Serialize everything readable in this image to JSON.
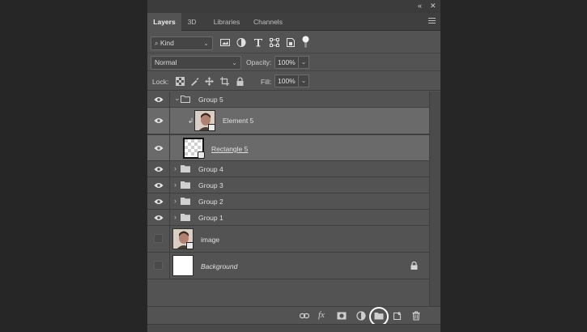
{
  "topbar": {
    "collapse_label": "«",
    "close_label": "✕"
  },
  "tabs": [
    {
      "label": "Layers",
      "active": true
    },
    {
      "label": "3D",
      "active": false
    },
    {
      "label": "Libraries",
      "active": false
    },
    {
      "label": "Channels",
      "active": false
    }
  ],
  "filter": {
    "kind_label": "Kind",
    "icons": [
      "pixel-filter-icon",
      "adjustment-filter-icon",
      "type-filter-icon",
      "shape-filter-icon",
      "smart-object-filter-icon",
      "filter-toggle-icon"
    ]
  },
  "blend": {
    "mode": "Normal",
    "opacity_label": "Opacity:",
    "opacity": "100%"
  },
  "lock": {
    "label": "Lock:",
    "fill_label": "Fill:",
    "fill": "100%"
  },
  "layers": [
    {
      "name": "Group 5",
      "type": "group",
      "expanded": true,
      "visible": true
    },
    {
      "name": "Element 5",
      "type": "smart-object",
      "clipped": true,
      "visible": true
    },
    {
      "name": "Rectangle 5",
      "type": "shape",
      "visible": true,
      "selected": true
    },
    {
      "name": "Group 4",
      "type": "group",
      "expanded": false,
      "visible": true
    },
    {
      "name": "Group 3",
      "type": "group",
      "expanded": false,
      "visible": true
    },
    {
      "name": "Group 2",
      "type": "group",
      "expanded": false,
      "visible": true
    },
    {
      "name": "Group 1",
      "type": "group",
      "expanded": false,
      "visible": true
    },
    {
      "name": "image",
      "type": "smart-object",
      "visible": false
    },
    {
      "name": "Background",
      "type": "background",
      "visible": false,
      "locked": true
    }
  ],
  "footer_icons": [
    "link-layers-icon",
    "fx-icon",
    "add-mask-icon",
    "adjustment-layer-icon",
    "new-group-icon",
    "new-layer-icon",
    "delete-layer-icon"
  ],
  "colors": {
    "panel": "#535353",
    "selected_row": "#6a6a6a",
    "tab_bar": "#3f3f3f",
    "highlight_ring": "#ffffff"
  }
}
